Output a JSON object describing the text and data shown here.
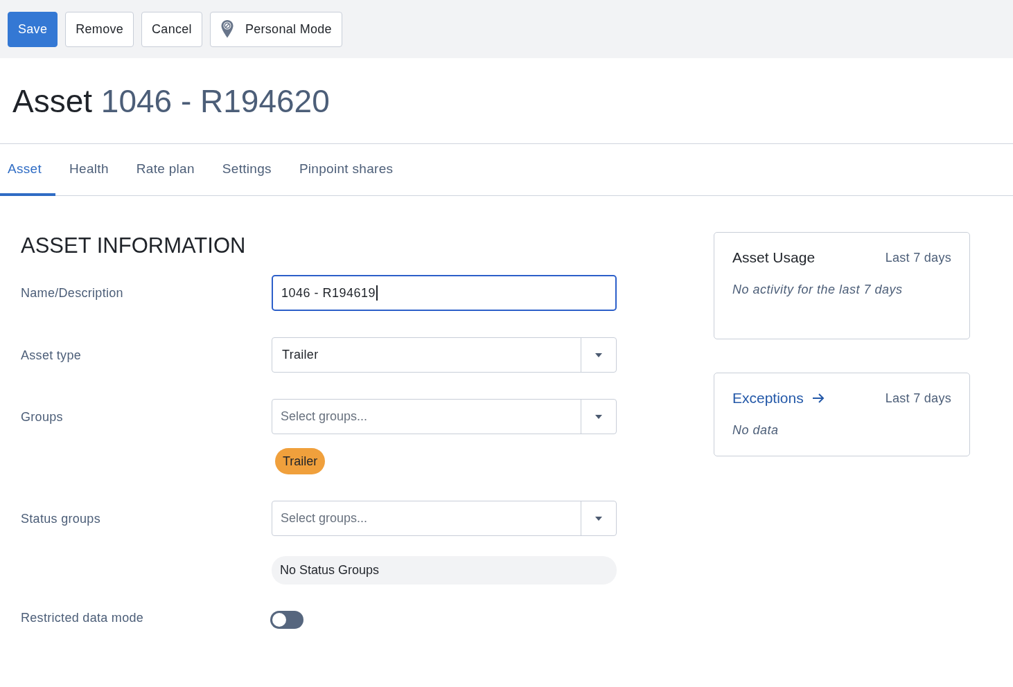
{
  "toolbar": {
    "buttons": [
      {
        "label": "Save",
        "kind": "primary"
      },
      {
        "label": "Remove",
        "kind": "plain"
      },
      {
        "label": "Cancel",
        "kind": "plain"
      },
      {
        "label": "Personal Mode",
        "kind": "icon"
      }
    ]
  },
  "title": {
    "prefix": "Asset",
    "name": "1046 - R194620"
  },
  "tabs": [
    {
      "label": "Asset",
      "selected": true
    },
    {
      "label": "Health",
      "selected": false
    },
    {
      "label": "Rate plan",
      "selected": false
    },
    {
      "label": "Settings",
      "selected": false
    },
    {
      "label": "Pinpoint shares",
      "selected": false
    }
  ],
  "section_title": "ASSET INFORMATION",
  "fields": [
    {
      "kind": "text",
      "label": "Name/Description",
      "value": "1046 - R194619",
      "focused": true
    },
    {
      "kind": "select",
      "label": "Asset type",
      "value": "Trailer"
    },
    {
      "kind": "multiselect",
      "label": "Groups",
      "placeholder": "Select groups...",
      "tags": [
        {
          "label": "Trailer",
          "color": "#f0a03c"
        }
      ]
    },
    {
      "kind": "multiselect",
      "label": "Status groups",
      "placeholder": "Select groups...",
      "empty_note": "No Status Groups"
    },
    {
      "kind": "toggle",
      "label": "Restricted data mode",
      "on": false
    }
  ],
  "cards": [
    {
      "title": "Asset Usage",
      "link": false,
      "period": "Last 7 days",
      "message": "No activity for the last 7 days"
    },
    {
      "title": "Exceptions",
      "link": true,
      "period": "Last 7 days",
      "message": "No data"
    }
  ]
}
